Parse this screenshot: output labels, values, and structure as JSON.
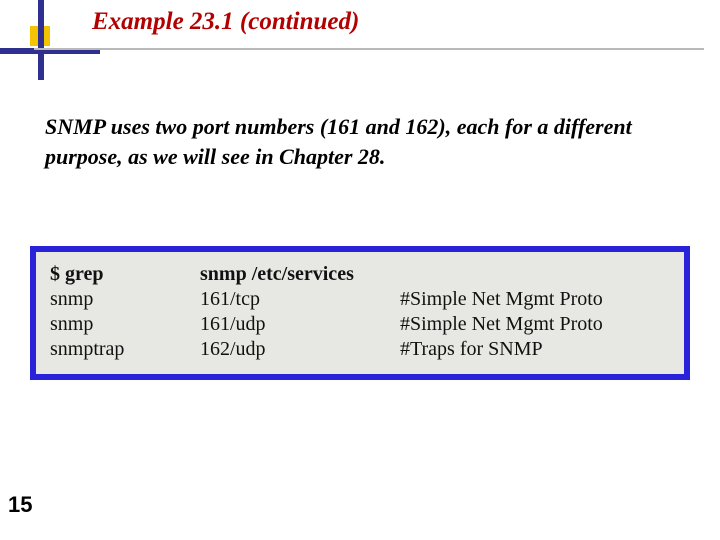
{
  "title": "Example 23.1 (continued)",
  "body": "SNMP uses two port numbers (161 and 162), each for a different purpose, as we will see in Chapter 28.",
  "code": {
    "cmd_col1": "$ grep",
    "cmd_col2": "snmp /etc/services",
    "rows": [
      {
        "name": "snmp",
        "port": "161/tcp",
        "comment": "#Simple Net  Mgmt Proto"
      },
      {
        "name": "snmp",
        "port": "161/udp",
        "comment": "#Simple Net  Mgmt Proto"
      },
      {
        "name": "snmptrap",
        "port": "162/udp",
        "comment": "#Traps for SNMP"
      }
    ]
  },
  "page_number": "15"
}
